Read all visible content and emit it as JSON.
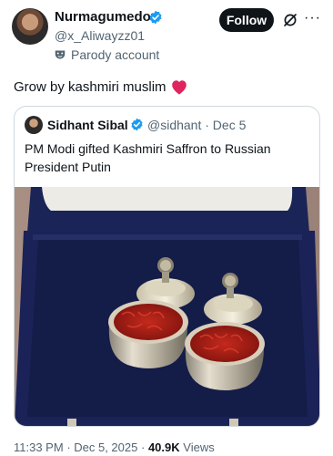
{
  "post": {
    "author": {
      "name": "Nurmagumedov",
      "handle": "@x_Aliwayzz01",
      "badge": "Parody account"
    },
    "follow_label": "Follow",
    "more_label": "···",
    "text": "Grow by kashmiri muslim",
    "heart_color": "#e0245e"
  },
  "quote": {
    "author": {
      "name": "Sidhant Sibal",
      "handle": "@sidhant",
      "date": "· Dec 5"
    },
    "text": "PM Modi gifted Kashmiri Saffron to Russian President Putin"
  },
  "footer": {
    "time": "11:33 PM",
    "date": "· Dec 5, 2025 ·",
    "views_count": "40.9K",
    "views_label": "Views"
  },
  "colors": {
    "verified": "#1d9bf0",
    "muted_text": "#536471",
    "box_blue": "#1a2257",
    "saffron": "#9b1b14"
  }
}
